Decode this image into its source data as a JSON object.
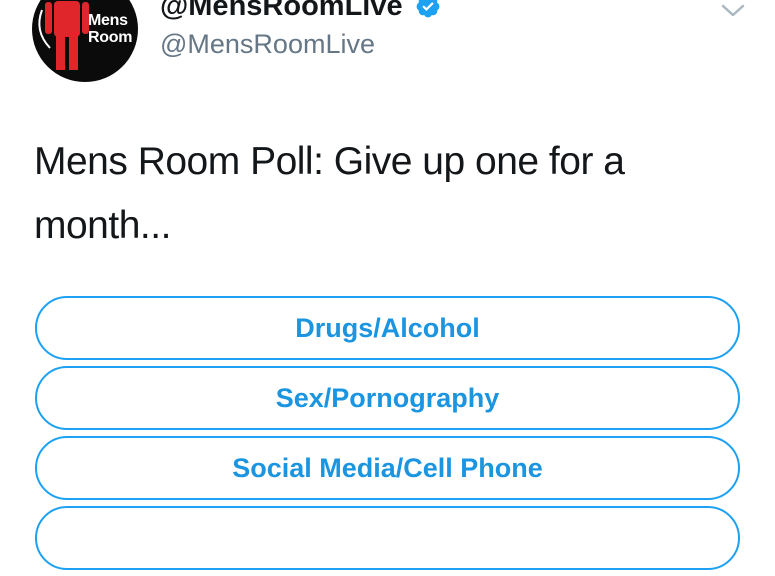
{
  "header": {
    "display_name": "@MensRoomLive",
    "handle": "@MensRoomLive",
    "avatar_text_line1": "Mens",
    "avatar_text_line2": "Room",
    "verified_icon": "verified-badge-icon",
    "caret_icon": "chevron-down-icon"
  },
  "tweet": {
    "text": "Mens Room Poll: Give up one for a month..."
  },
  "poll": {
    "options": [
      {
        "label": "Drugs/Alcohol"
      },
      {
        "label": "Sex/Pornography"
      },
      {
        "label": "Social Media/Cell Phone"
      },
      {
        "label": ""
      }
    ]
  },
  "colors": {
    "accent": "#1da1f2",
    "option_text": "#1b95e0",
    "handle_gray": "#657786",
    "text": "#14171a",
    "avatar_bg": "#0b0b0b",
    "avatar_figure": "#e0262a"
  }
}
